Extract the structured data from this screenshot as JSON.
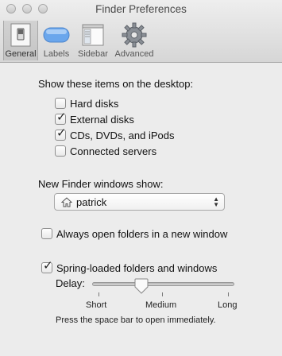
{
  "window": {
    "title": "Finder Preferences"
  },
  "toolbar": {
    "tabs": [
      {
        "label": "General",
        "icon": "light-switch-icon",
        "selected": true
      },
      {
        "label": "Labels",
        "icon": "label-tag-icon",
        "selected": false
      },
      {
        "label": "Sidebar",
        "icon": "sidebar-window-icon",
        "selected": false
      },
      {
        "label": "Advanced",
        "icon": "gear-icon",
        "selected": false
      }
    ]
  },
  "desktop": {
    "heading": "Show these items on the desktop:",
    "items": [
      {
        "label": "Hard disks",
        "checked": false
      },
      {
        "label": "External disks",
        "checked": true
      },
      {
        "label": "CDs, DVDs, and iPods",
        "checked": true
      },
      {
        "label": "Connected servers",
        "checked": false
      }
    ]
  },
  "new_window": {
    "heading": "New Finder windows show:",
    "selected": "patrick",
    "icon": "home-icon"
  },
  "always_open": {
    "label": "Always open folders in a new window",
    "checked": false
  },
  "spring_loaded": {
    "label": "Spring-loaded folders and windows",
    "checked": true,
    "delay_label": "Delay:",
    "delay_value": 0.35,
    "ticks": {
      "short": "Short",
      "medium": "Medium",
      "long": "Long"
    },
    "hint": "Press the space bar to open immediately."
  },
  "colors": {
    "label_tab_blue": "#5f9ee8",
    "window_bg": "#ececec"
  }
}
